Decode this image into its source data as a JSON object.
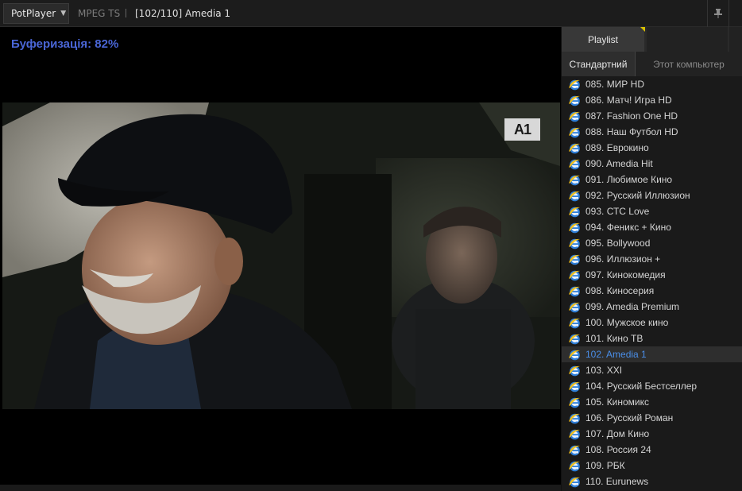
{
  "app": {
    "menu_label": "PotPlayer",
    "codec": "MPEG TS",
    "now_playing": "[102/110] Amedia 1"
  },
  "video": {
    "buffering_text": "Буферизація: 82%",
    "channel_logo": "A1"
  },
  "playlist": {
    "tab_label": "Playlist",
    "subtabs": [
      "Стандартний",
      "Этот компьютер"
    ],
    "items": [
      {
        "label": "085. МИР HD",
        "current": false
      },
      {
        "label": "086. Матч! Игра HD",
        "current": false
      },
      {
        "label": "087. Fashion One HD",
        "current": false
      },
      {
        "label": "088. Наш Футбол HD",
        "current": false
      },
      {
        "label": "089. Еврокино",
        "current": false
      },
      {
        "label": "090. Amedia Hit",
        "current": false
      },
      {
        "label": "091. Любимое Кино",
        "current": false
      },
      {
        "label": "092. Русский Иллюзион",
        "current": false
      },
      {
        "label": "093. СТС Love",
        "current": false
      },
      {
        "label": "094. Феникс + Кино",
        "current": false
      },
      {
        "label": "095. Bollywood",
        "current": false
      },
      {
        "label": "096. Иллюзион +",
        "current": false
      },
      {
        "label": "097. Кинокомедия",
        "current": false
      },
      {
        "label": "098. Киносерия",
        "current": false
      },
      {
        "label": "099. Amedia Premium",
        "current": false
      },
      {
        "label": "100. Мужское кино",
        "current": false
      },
      {
        "label": "101. Кино ТВ",
        "current": false
      },
      {
        "label": "102. Amedia 1",
        "current": true
      },
      {
        "label": "103. XXI",
        "current": false
      },
      {
        "label": "104. Русский Бестселлер",
        "current": false
      },
      {
        "label": "105. Киномикс",
        "current": false
      },
      {
        "label": "106. Русский Роман",
        "current": false
      },
      {
        "label": "107. Дом Кино",
        "current": false
      },
      {
        "label": "108. Россия 24",
        "current": false
      },
      {
        "label": "109. РБК",
        "current": false
      },
      {
        "label": "110. Eurunews",
        "current": false
      }
    ]
  },
  "colors": {
    "buffering": "#4a66d6",
    "current_item": "#4a8ee8",
    "tab_marker": "#d8c000"
  },
  "icons": {
    "item": "internet-explorer-icon",
    "pin": "pin-icon"
  }
}
